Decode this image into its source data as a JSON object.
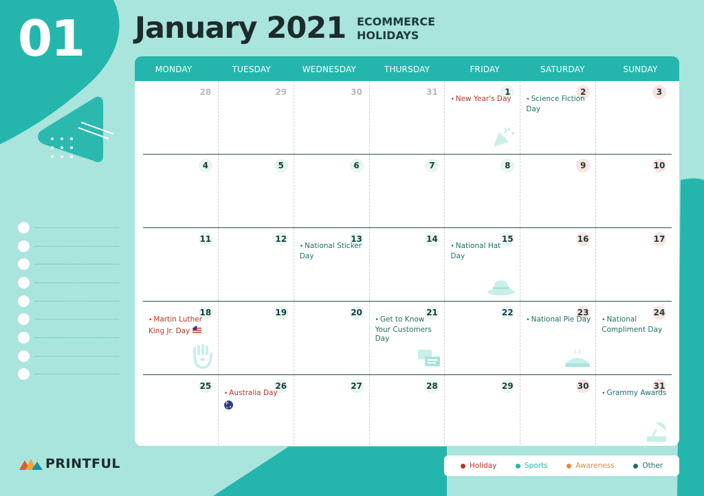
{
  "header": {
    "month_number": "01",
    "title": "January 2021",
    "subtitle_line1": "ECOMMERCE",
    "subtitle_line2": "HOLIDAYS"
  },
  "calendar": {
    "weekdays": [
      "MONDAY",
      "TUESDAY",
      "WEDNESDAY",
      "THURSDAY",
      "FRIDAY",
      "SATURDAY",
      "SUNDAY"
    ],
    "weeks": [
      [
        {
          "n": "28",
          "kind": "other"
        },
        {
          "n": "29",
          "kind": "other"
        },
        {
          "n": "30",
          "kind": "other"
        },
        {
          "n": "31",
          "kind": "other"
        },
        {
          "n": "1",
          "kind": "mon",
          "event": "New Year's Day",
          "type": "holiday",
          "icon": "party-popper-icon"
        },
        {
          "n": "2",
          "kind": "wk",
          "event": "Science Fiction Day",
          "type": "other"
        },
        {
          "n": "3",
          "kind": "wk"
        }
      ],
      [
        {
          "n": "4",
          "kind": "mon"
        },
        {
          "n": "5",
          "kind": "mon"
        },
        {
          "n": "6",
          "kind": "mon"
        },
        {
          "n": "7",
          "kind": "mon"
        },
        {
          "n": "8",
          "kind": "mon"
        },
        {
          "n": "9",
          "kind": "wk"
        },
        {
          "n": "10",
          "kind": "wk"
        }
      ],
      [
        {
          "n": "11",
          "kind": "mon"
        },
        {
          "n": "12",
          "kind": "mon"
        },
        {
          "n": "13",
          "kind": "mon",
          "event": "National Sticker Day",
          "type": "other"
        },
        {
          "n": "14",
          "kind": "mon"
        },
        {
          "n": "15",
          "kind": "mon",
          "event": "National Hat Day",
          "type": "other",
          "icon": "hat-icon"
        },
        {
          "n": "16",
          "kind": "wk"
        },
        {
          "n": "17",
          "kind": "wk"
        }
      ],
      [
        {
          "n": "18",
          "kind": "mon",
          "event": "Martin Luther King Jr. Day",
          "type": "holiday",
          "icon": "hand-icon",
          "flag": "us-flag-icon"
        },
        {
          "n": "19",
          "kind": "mon"
        },
        {
          "n": "20",
          "kind": "mon"
        },
        {
          "n": "21",
          "kind": "mon",
          "event": "Get to Know Your Customers Day",
          "type": "other",
          "icon": "chat-bubbles-icon"
        },
        {
          "n": "22",
          "kind": "mon"
        },
        {
          "n": "23",
          "kind": "wk",
          "event": "National Pie Day",
          "type": "other",
          "icon": "pie-icon"
        },
        {
          "n": "24",
          "kind": "wk",
          "event": "National Compliment Day",
          "type": "other"
        }
      ],
      [
        {
          "n": "25",
          "kind": "mon"
        },
        {
          "n": "26",
          "kind": "mon",
          "event": "Australia Day",
          "type": "holiday",
          "flag": "au-flag-icon"
        },
        {
          "n": "27",
          "kind": "mon"
        },
        {
          "n": "28",
          "kind": "mon"
        },
        {
          "n": "29",
          "kind": "mon"
        },
        {
          "n": "30",
          "kind": "wk"
        },
        {
          "n": "31",
          "kind": "wk",
          "event": "Grammy Awards",
          "type": "other",
          "icon": "gramophone-icon"
        }
      ]
    ]
  },
  "legend": [
    {
      "label": "Holiday",
      "color": "#b53329"
    },
    {
      "label": "Sports",
      "color": "#2ab6ac"
    },
    {
      "label": "Awareness",
      "color": "#e08a3c"
    },
    {
      "label": "Other",
      "color": "#1e6e66"
    }
  ],
  "brand": {
    "name": "PRINTFUL"
  },
  "colors": {
    "teal": "#24b6ac",
    "mint": "#a9e4dd",
    "dark": "#1d2b2b"
  }
}
